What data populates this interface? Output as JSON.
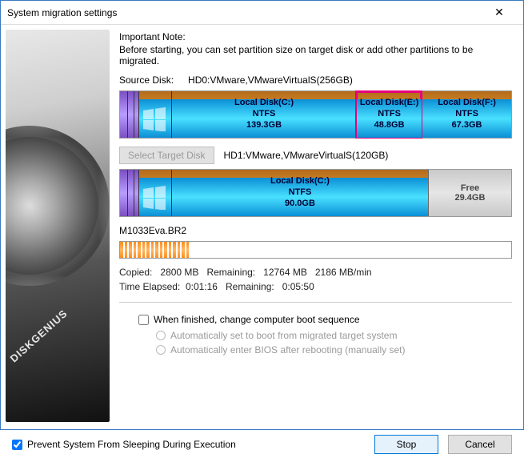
{
  "window": {
    "title": "System migration settings",
    "close": "✕"
  },
  "note": {
    "title": "Important Note:",
    "body": "Before starting, you can set partition size on target disk or add other partitions to be migrated."
  },
  "source": {
    "label": "Source Disk:",
    "value": "HD0:VMware,VMwareVirtualS(256GB)",
    "partitions": [
      {
        "name": "Local Disk(C:)",
        "fs": "NTFS",
        "size": "139.3GB",
        "selected": false
      },
      {
        "name": "Local Disk(E:)",
        "fs": "NTFS",
        "size": "48.8GB",
        "selected": true
      },
      {
        "name": "Local Disk(F:)",
        "fs": "NTFS",
        "size": "67.3GB",
        "selected": false
      }
    ]
  },
  "target": {
    "button": "Select Target Disk",
    "value": "HD1:VMware,VMwareVirtualS(120GB)",
    "partitions": [
      {
        "name": "Local Disk(C:)",
        "fs": "NTFS",
        "size": "90.0GB"
      }
    ],
    "free": {
      "label": "Free",
      "size": "29.4GB"
    }
  },
  "progress": {
    "file": "M1033Eva.BR2",
    "percent": 18,
    "copied_label": "Copied:",
    "copied": "2800 MB",
    "remaining_label": "Remaining:",
    "remaining": "12764 MB",
    "rate": "2186 MB/min",
    "elapsed_label": "Time Elapsed:",
    "elapsed": "0:01:16",
    "eta_label": "Remaining:",
    "eta": "0:05:50"
  },
  "options": {
    "change_boot": "When finished, change computer boot sequence",
    "radio1": "Automatically set to boot from migrated target system",
    "radio2": "Automatically enter BIOS after rebooting (manually set)"
  },
  "footer": {
    "prevent_sleep": "Prevent System From Sleeping During Execution",
    "stop": "Stop",
    "cancel": "Cancel"
  },
  "brand": "DISKGENIUS"
}
